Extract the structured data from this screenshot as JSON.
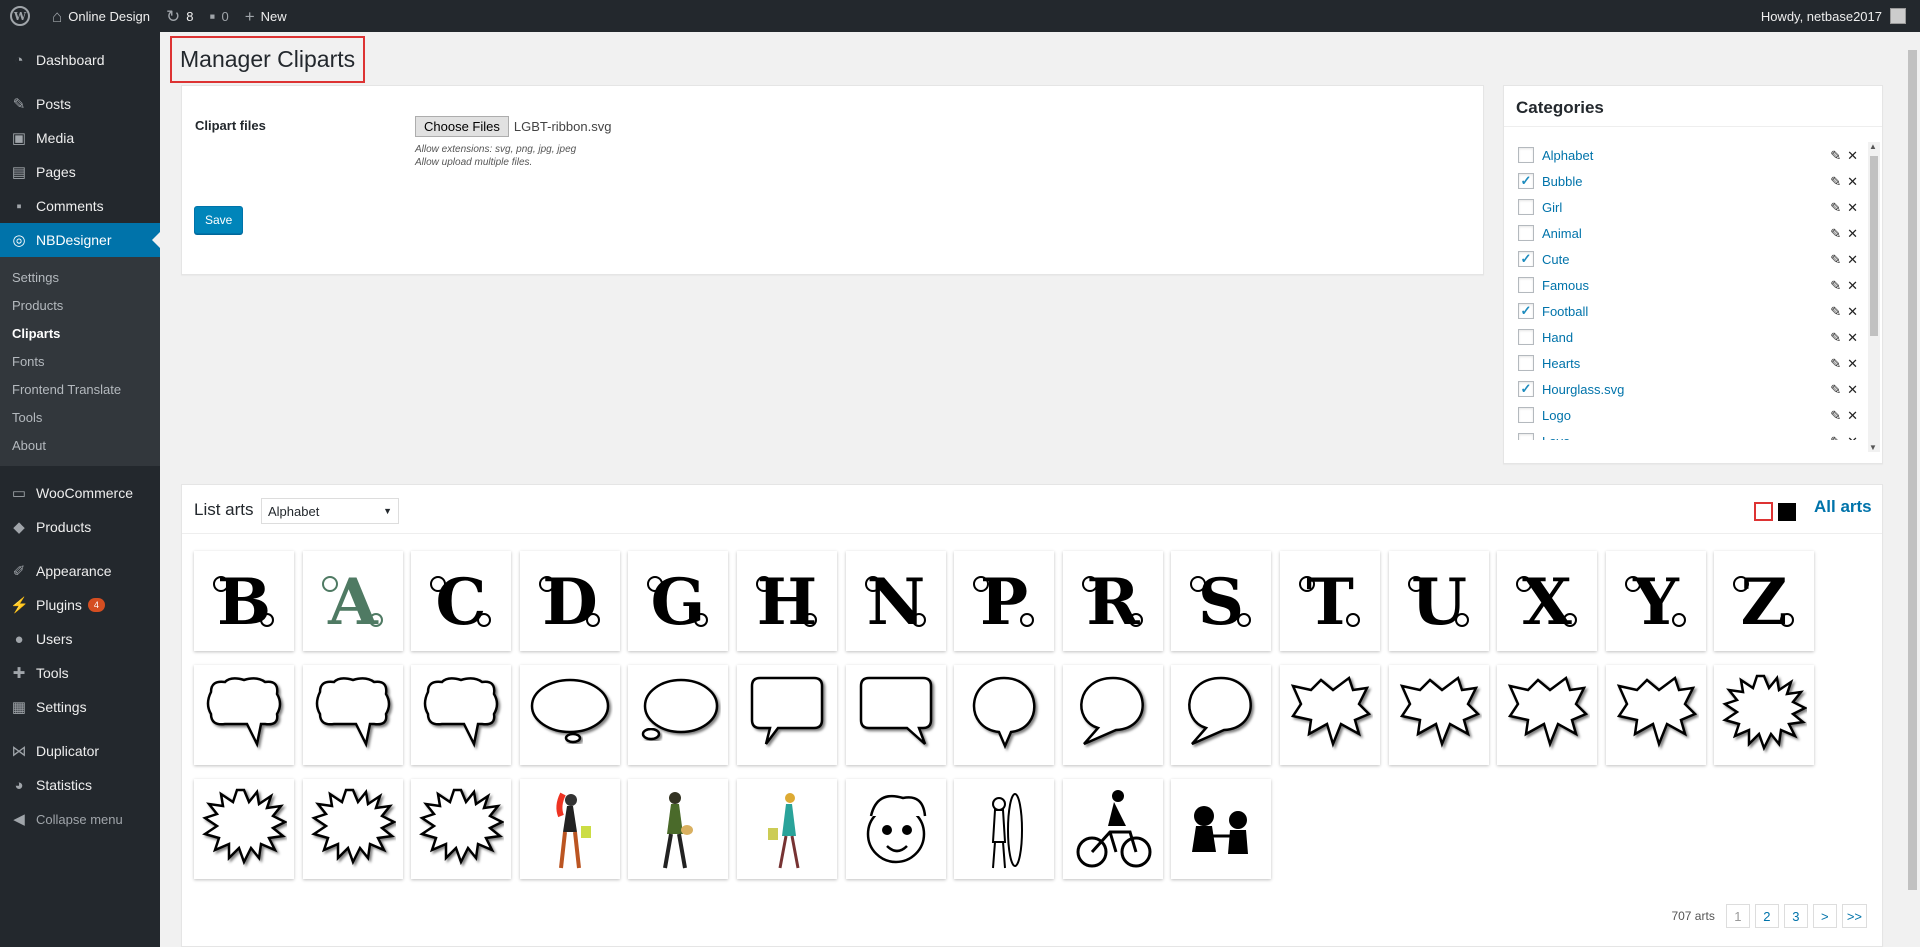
{
  "admin_bar": {
    "site_name": "Online Design",
    "updates_count": "8",
    "comments_count": "0",
    "new_label": "New",
    "greeting": "Howdy, netbase2017"
  },
  "sidebar": {
    "items": [
      {
        "label": "Dashboard",
        "icon": "dashboard-icon",
        "glyph": "◔"
      },
      {
        "label": "Posts",
        "icon": "pin-icon",
        "glyph": "✎"
      },
      {
        "label": "Media",
        "icon": "media-icon",
        "glyph": "▣"
      },
      {
        "label": "Pages",
        "icon": "pages-icon",
        "glyph": "▤"
      },
      {
        "label": "Comments",
        "icon": "comments-icon",
        "glyph": "▪"
      },
      {
        "label": "NBDesigner",
        "icon": "nbdesigner-icon",
        "glyph": "◎"
      }
    ],
    "submenu": [
      "Settings",
      "Products",
      "Cliparts",
      "Fonts",
      "Frontend Translate",
      "Tools",
      "About"
    ],
    "items2": [
      {
        "label": "WooCommerce",
        "icon": "woocommerce-icon",
        "glyph": "▭"
      },
      {
        "label": "Products",
        "icon": "products-icon",
        "glyph": "◆"
      }
    ],
    "items3": [
      {
        "label": "Appearance",
        "icon": "appearance-icon",
        "glyph": "✐"
      },
      {
        "label": "Plugins",
        "icon": "plugins-icon",
        "glyph": "⚡"
      },
      {
        "label": "Users",
        "icon": "users-icon",
        "glyph": "●"
      },
      {
        "label": "Tools",
        "icon": "tools-icon",
        "glyph": "✚"
      },
      {
        "label": "Settings",
        "icon": "settings-icon",
        "glyph": "▦"
      }
    ],
    "plugins_badge": "4",
    "items4": [
      {
        "label": "Duplicator",
        "icon": "duplicator-icon",
        "glyph": "⋈"
      },
      {
        "label": "Statistics",
        "icon": "statistics-icon",
        "glyph": "◕"
      }
    ],
    "collapse_label": "Collapse menu"
  },
  "page": {
    "title": "Manager Cliparts"
  },
  "upload": {
    "label": "Clipart files",
    "choose_button": "Choose Files",
    "file_name": "LGBT-ribbon.svg",
    "hint1": "Allow extensions: svg, png, jpg, jpeg",
    "hint2": "Allow upload multiple files.",
    "save_label": "Save"
  },
  "categories": {
    "title": "Categories",
    "items": [
      {
        "name": "Alphabet",
        "checked": false
      },
      {
        "name": "Bubble",
        "checked": true
      },
      {
        "name": "Girl",
        "checked": false
      },
      {
        "name": "Animal",
        "checked": false
      },
      {
        "name": "Cute",
        "checked": true
      },
      {
        "name": "Famous",
        "checked": false
      },
      {
        "name": "Football",
        "checked": true
      },
      {
        "name": "Hand",
        "checked": false
      },
      {
        "name": "Hearts",
        "checked": false
      },
      {
        "name": "Hourglass.svg",
        "checked": true
      },
      {
        "name": "Logo",
        "checked": false
      },
      {
        "name": "Love",
        "checked": false
      }
    ]
  },
  "arts": {
    "title": "List arts",
    "selected_category": "Alphabet",
    "all_arts_label": "All arts",
    "letters": [
      "B",
      "A",
      "C",
      "D",
      "G",
      "H",
      "N",
      "P",
      "R",
      "S",
      "T",
      "U",
      "X",
      "Y",
      "Z"
    ],
    "total": "707 arts",
    "pages": [
      "1",
      "2",
      "3",
      ">",
      ">>"
    ]
  }
}
